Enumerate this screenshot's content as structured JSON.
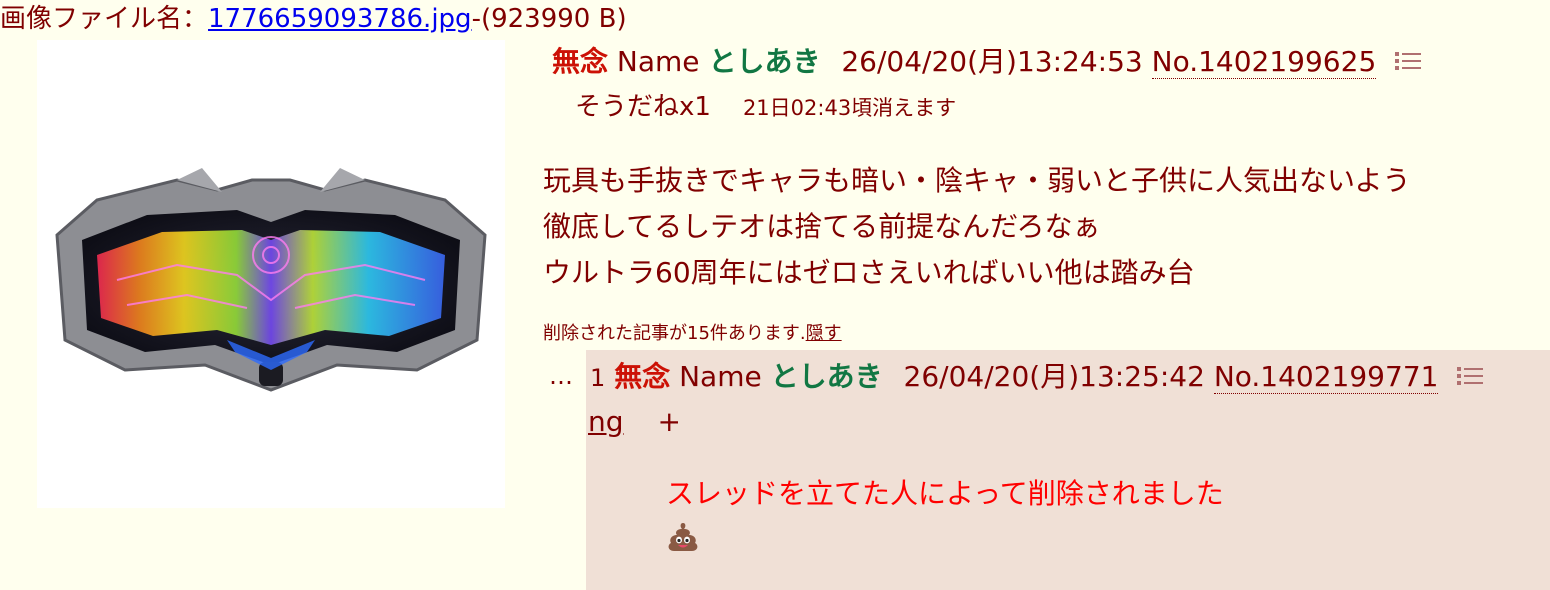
{
  "file": {
    "prefix": "画像ファイル名：",
    "filename": "1776659093786.jpg",
    "size": "-(923990 B)"
  },
  "op": {
    "subject": "無念",
    "name_label": "Name",
    "name": "としあき",
    "datetime": "26/04/20(月)13:24:53",
    "number": "No.1402199625",
    "soudane": "そうだねx1",
    "expire": "21日02:43頃消えます",
    "lines": [
      "玩具も手抜きでキャラも暗い・陰キャ・弱いと子供に人気出ないよう",
      "徹底してるしテオは捨てる前提なんだろなぁ",
      "ウルトラ60周年にはゼロさえいればいい他は踏み台"
    ]
  },
  "deleted_notice": {
    "text": "削除された記事が15件あります.",
    "hide_link": "隠す"
  },
  "reply": {
    "ellipsis": "…",
    "index": "1",
    "subject": "無念",
    "name_label": "Name",
    "name": "としあき",
    "datetime": "26/04/20(月)13:25:42",
    "number": "No.1402199771",
    "ng": "ng",
    "plus": "+",
    "deleted_text": "スレッドを立てた人によって削除されました",
    "emoji_icon": "pile-of-poo-icon"
  },
  "colors": {
    "background": "#ffffee",
    "text": "#800000",
    "subject": "#cc1105",
    "name": "#117743",
    "reply_bg": "#f0e0d6",
    "deleted": "#ff0000",
    "link": "#0000ee"
  }
}
